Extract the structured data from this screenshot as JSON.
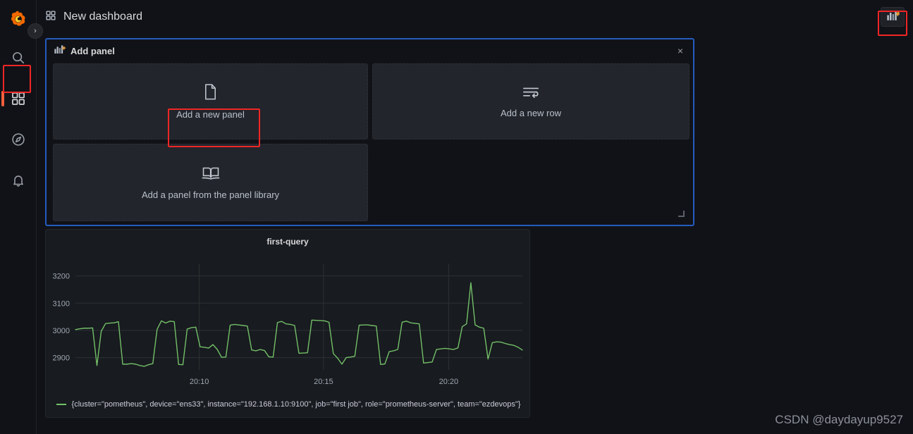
{
  "sidebar": {
    "brand_icon": "grafana-logo-icon",
    "expand_label": "›",
    "items": [
      {
        "name": "search",
        "icon": "search-icon",
        "label": "Search"
      },
      {
        "name": "dashboards",
        "icon": "dashboards-grid-icon",
        "label": "Dashboards",
        "active": true
      },
      {
        "name": "explore",
        "icon": "compass-icon",
        "label": "Explore"
      },
      {
        "name": "alerting",
        "icon": "bell-icon",
        "label": "Alerting"
      }
    ]
  },
  "header": {
    "icon": "dashboards-grid-icon",
    "title": "New dashboard",
    "add_panel_button": {
      "name": "add-panel-toolbar-button",
      "icon": "bar-chart-plus-icon",
      "label": "Add panel"
    }
  },
  "add_panel_widget": {
    "icon": "bar-chart-plus-icon",
    "title": "Add panel",
    "close_label": "×",
    "options": [
      {
        "key": "new_panel",
        "icon": "file-blank-icon",
        "label": "Add a new panel",
        "highlighted": true
      },
      {
        "key": "new_row",
        "icon": "wrap-text-icon",
        "label": "Add a new row",
        "highlighted": false
      },
      {
        "key": "library",
        "icon": "open-book-icon",
        "label": "Add a panel from the panel library",
        "highlighted": false
      }
    ],
    "resize_handle": "panel-resize-handle",
    "border_color": "#245bbf"
  },
  "chart_panel": {
    "legend_label": "{cluster=\"pometheus\", device=\"ens33\", instance=\"192.168.1.10:9100\", job=\"first job\", role=\"prometheus-server\", team=\"ezdevops\"}",
    "series_color": "#73bf69"
  },
  "annotations": {
    "accent_color": "#ef2626",
    "boxes": [
      "nav-dashboards-highlight",
      "add-new-panel-highlight",
      "toolbar-add-panel-highlight"
    ]
  },
  "watermark": "CSDN @daydayup9527",
  "chart_data": {
    "type": "line",
    "title": "first-query",
    "xlabel": "",
    "ylabel": "",
    "grid": true,
    "legend_position": "bottom",
    "series_name": "{cluster=\"pometheus\", device=\"ens33\", instance=\"192.168.1.10:9100\", job=\"first job\", role=\"prometheus-server\", team=\"ezdevops\"}",
    "series_color": "#73bf69",
    "ylim": [
      2855,
      3225
    ],
    "yticks": [
      2900,
      3000,
      3100,
      3200
    ],
    "xticks": [
      "20:10",
      "20:15",
      "20:20"
    ],
    "xtick_positions": [
      0.277,
      0.555,
      0.835
    ],
    "xlim_labels": [
      "20:08",
      "20:22"
    ],
    "x": [
      0,
      1,
      2,
      3,
      4,
      5,
      6,
      7,
      8,
      9,
      10,
      11,
      12,
      13,
      14,
      15,
      16,
      17,
      18,
      19,
      20,
      21,
      22,
      23,
      24,
      25,
      26,
      27,
      28,
      29,
      30,
      31,
      32,
      33,
      34,
      35,
      36,
      37,
      38,
      39,
      40,
      41,
      42,
      43,
      44,
      45,
      46,
      47,
      48,
      49,
      50,
      51,
      52,
      53,
      54,
      55,
      56,
      57,
      58,
      59,
      60,
      61,
      62,
      63,
      64,
      65,
      66,
      67,
      68,
      69,
      70,
      71,
      72,
      73,
      74,
      75,
      76,
      77,
      78,
      79,
      80,
      81,
      82,
      83,
      84,
      85,
      86,
      87,
      88,
      89,
      90,
      91,
      92,
      93,
      94,
      95,
      96,
      97,
      98,
      99,
      100,
      101,
      102,
      103,
      104
    ],
    "values": [
      3003,
      3006,
      3008,
      3008,
      3009,
      2871,
      2997,
      3025,
      3027,
      3028,
      3032,
      2876,
      2876,
      2878,
      2876,
      2871,
      2868,
      2874,
      2878,
      3004,
      3035,
      3027,
      3034,
      3032,
      2875,
      2874,
      3005,
      3010,
      3012,
      2940,
      2938,
      2935,
      2948,
      2930,
      2901,
      2902,
      3019,
      3022,
      3020,
      3018,
      3016,
      2928,
      2925,
      2930,
      2926,
      2903,
      2902,
      3029,
      3033,
      3024,
      3022,
      3018,
      2916,
      2917,
      2918,
      3038,
      3037,
      3036,
      3035,
      3030,
      2915,
      2898,
      2876,
      2900,
      2902,
      2905,
      3019,
      3020,
      3020,
      3018,
      3016,
      2875,
      2877,
      2922,
      2925,
      2930,
      3030,
      3034,
      3028,
      3026,
      3024,
      2880,
      2882,
      2884,
      2930,
      2932,
      2934,
      2932,
      2930,
      2936,
      3014,
      3024,
      3175,
      3020,
      3012,
      3008,
      2895,
      2955,
      2958,
      2957,
      2952,
      2948,
      2945,
      2938,
      2928
    ],
    "description": "Oscillating square-wave-like metric cycling between roughly 2870 and 3040 with a single spike to about 3175 near 20:21"
  }
}
